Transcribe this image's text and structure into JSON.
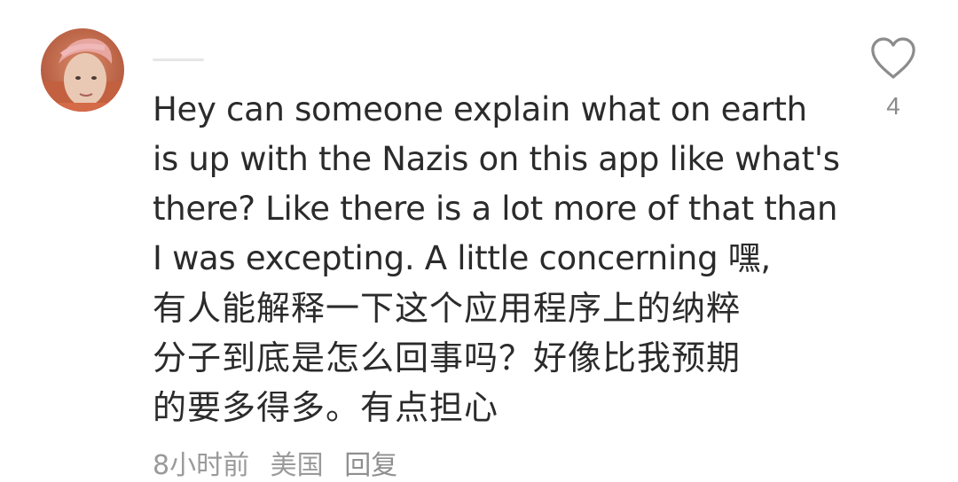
{
  "comment": {
    "text_lines": [
      "Hey can someone explain what on earth",
      "is up with the Nazis on this app like what's",
      "there? Like there is a lot more of that than",
      "I was excepting. A little concerning 嘿,",
      "有人能解释一下这个应用程序上的纳粹",
      "分子到底是怎么回事吗？好像比我预期",
      "的要多得多。有点担心"
    ],
    "like_count": "4",
    "time": "8小时前",
    "location": "美国",
    "reply_label": "回复"
  },
  "icons": {
    "like": "heart-outline-icon",
    "avatar": "user-avatar"
  },
  "colors": {
    "text": "#2b2b2b",
    "meta": "#9a9a9a",
    "like_count": "#8a8a8a"
  }
}
